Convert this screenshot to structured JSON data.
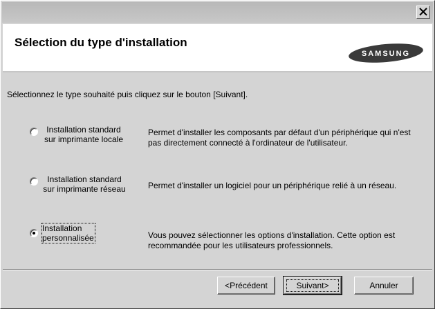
{
  "window": {
    "close_icon": "close-icon"
  },
  "header": {
    "title": "Sélection du type d'installation",
    "logo_text": "SAMSUNG"
  },
  "instruction": "Sélectionnez le type souhaité puis cliquez sur le bouton [Suivant].",
  "options": [
    {
      "label_line1": "Installation standard",
      "label_line2": "sur imprimante locale",
      "desc_line1": "Permet d'installer les composants par défaut d'un périphérique qui n'est",
      "desc_line2": "pas directement connecté à l'ordinateur de l'utilisateur.",
      "selected": false
    },
    {
      "label_line1": "Installation standard",
      "label_line2": "sur imprimante réseau",
      "desc_line1": "Permet d'installer un logiciel pour un périphérique relié à un réseau.",
      "desc_line2": "",
      "selected": false
    },
    {
      "label_line1": "Installation",
      "label_line2": "personnalisée",
      "desc_line1": "Vous pouvez sélectionner les options d'installation. Cette option est",
      "desc_line2": "recommandée pour les utilisateurs professionnels.",
      "selected": true
    }
  ],
  "buttons": {
    "previous": "<Précédent",
    "next": "Suivant>",
    "cancel": "Annuler"
  },
  "colors": {
    "dialog_bg": "#d4d4d4",
    "header_bg": "#ffffff",
    "logo_bg": "#3a3a3a"
  }
}
